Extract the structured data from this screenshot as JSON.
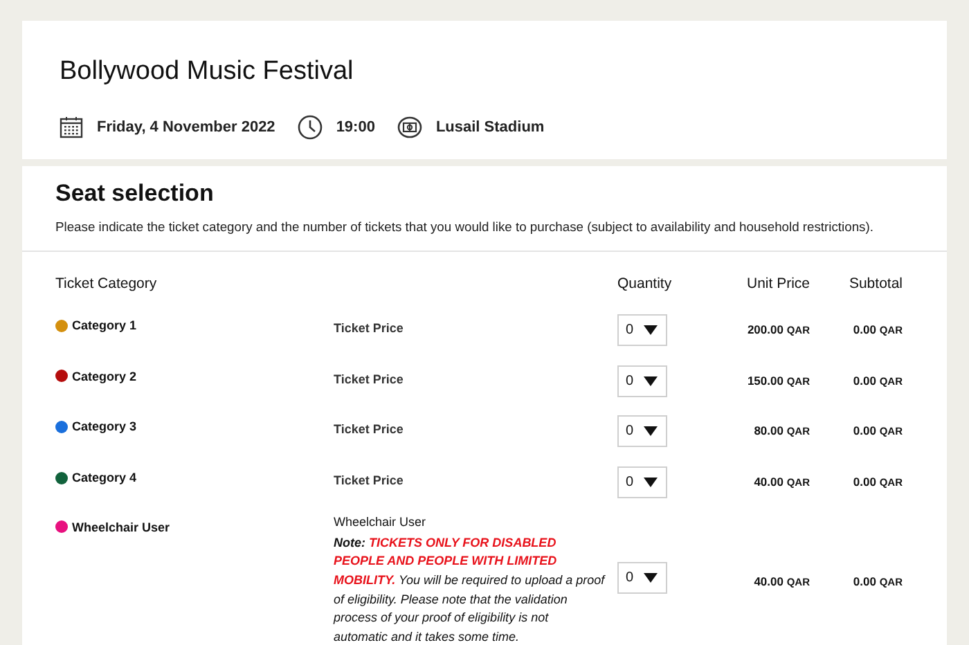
{
  "event": {
    "title": "Bollywood Music Festival",
    "date": "Friday, 4 November 2022",
    "time": "19:00",
    "venue": "Lusail Stadium"
  },
  "seat_selection": {
    "title": "Seat selection",
    "instructions": "Please indicate the ticket category and the number of tickets that you would like to purchase (subject to availability and household restrictions).",
    "columns": [
      "Ticket Category",
      "Quantity",
      "Unit Price",
      "Subtotal"
    ],
    "rows": [
      {
        "category": "Category 1",
        "color": "#d4900f",
        "price_label": "Ticket Price",
        "quantity": "0",
        "unit_price": "200.00",
        "subtotal": "0.00",
        "unit_currency": "QAR",
        "subtotal_currency": "QAR"
      },
      {
        "category": "Category 2",
        "color": "#b50d0d",
        "price_label": "Ticket Price",
        "quantity": "0",
        "unit_price": "150.00",
        "subtotal": "0.00",
        "unit_currency": "QAR",
        "subtotal_currency": "QAR"
      },
      {
        "category": "Category 3",
        "color": "#1a6fdc",
        "price_label": "Ticket Price",
        "quantity": "0",
        "unit_price": "80.00",
        "subtotal": "0.00",
        "unit_currency": "QAR",
        "subtotal_currency": "QAR"
      },
      {
        "category": "Category 4",
        "color": "#11623c",
        "price_label": "Ticket Price",
        "quantity": "0",
        "unit_price": "40.00",
        "subtotal": "0.00",
        "unit_currency": "QAR",
        "subtotal_currency": "QAR"
      },
      {
        "category": "Wheelchair User",
        "color": "#e8117f",
        "price_label": "Wheelchair User",
        "note": {
          "label": "Note:",
          "warning": "TICKETS ONLY FOR DISABLED PEOPLE AND PEOPLE WITH LIMITED MOBILITY.",
          "text": "You will be required to upload a proof of eligibility. Please note that the validation process of your proof of eligibility is not automatic and it takes some time."
        },
        "quantity": "0",
        "unit_price": "40.00",
        "subtotal": "0.00",
        "unit_currency": "QAR",
        "subtotal_currency": "QAR"
      }
    ]
  }
}
